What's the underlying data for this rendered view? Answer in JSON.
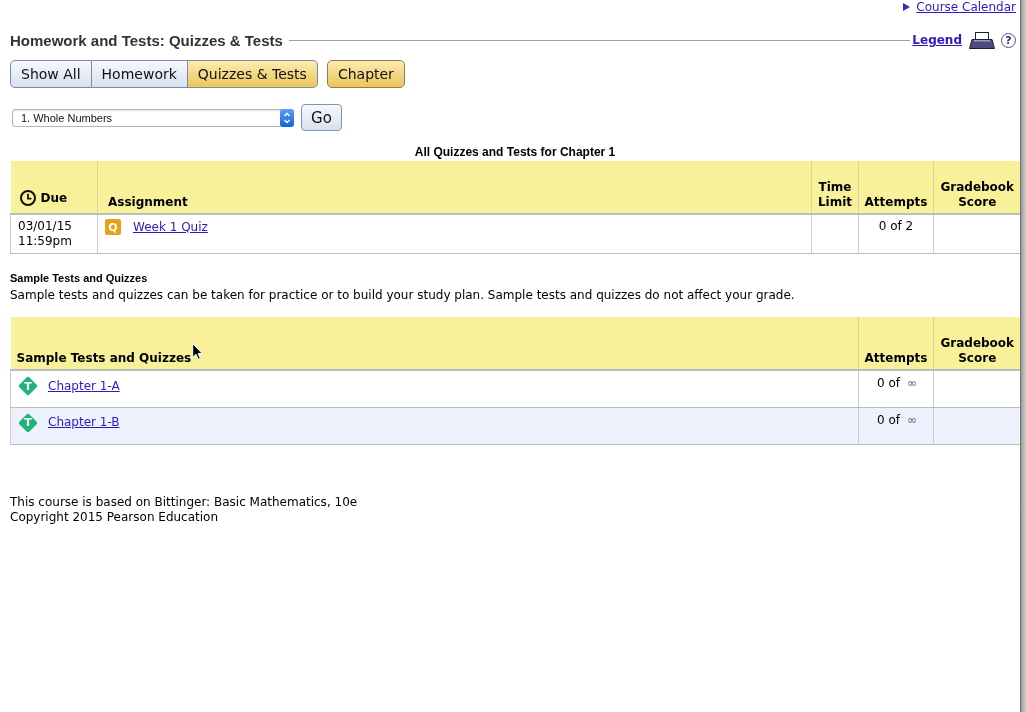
{
  "header": {
    "calendar_link": "Course Calendar",
    "title": "Homework and Tests: Quizzes & Tests",
    "legend_link": "Legend",
    "help": "?"
  },
  "filters": {
    "buttons": [
      {
        "label": "Show All",
        "selected": false
      },
      {
        "label": "Homework",
        "selected": false
      },
      {
        "label": "Quizzes & Tests",
        "selected": true
      }
    ],
    "chapter_button": {
      "label": "Chapter",
      "on": true
    }
  },
  "chapter_select": {
    "value": "1. Whole Numbers",
    "go_button": "Go"
  },
  "assignments": {
    "caption": "All Quizzes and Tests for Chapter 1",
    "columns": [
      "Due",
      "Assignment",
      "Time Limit",
      "Attempts",
      "Gradebook Score"
    ],
    "rows": [
      {
        "due": "03/01/15 11:59pm",
        "kind": "quiz",
        "badge": "Q",
        "assignment": "Week 1 Quiz",
        "attempts": "0 of 2"
      }
    ]
  },
  "samples": {
    "heading": "Sample Tests and Quizzes",
    "description": "Sample tests and quizzes can be taken for practice or to build your study plan. Sample tests and quizzes do not affect your grade.",
    "columns": [
      "Sample Tests and Quizzes",
      "Attempts",
      "Gradebook Score"
    ],
    "rows": [
      {
        "kind": "test",
        "badge": "T",
        "name": "Chapter 1-A",
        "attempts": "0 of",
        "attempts_limit": "∞"
      },
      {
        "kind": "test",
        "badge": "T",
        "name": "Chapter 1-B",
        "attempts": "0 of",
        "attempts_limit": "∞"
      }
    ]
  },
  "footer": [
    "This course is based on Bittinger: Basic Mathematics, 10e",
    "Copyright 2015 Pearson Education"
  ]
}
